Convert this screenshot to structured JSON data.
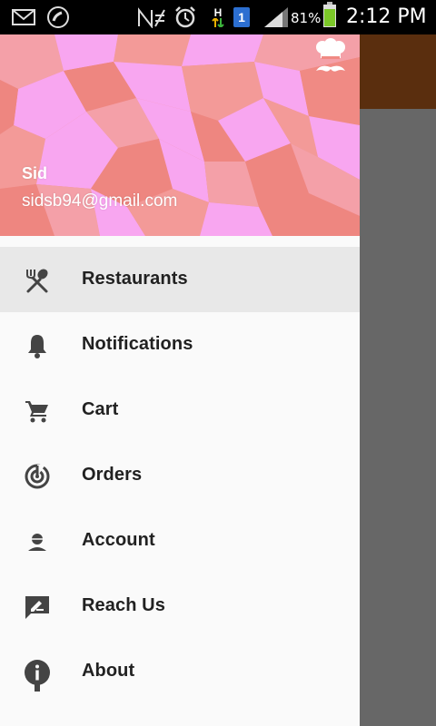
{
  "status_bar": {
    "battery_percent": "81%",
    "time": "2:12 PM",
    "network_type": "H",
    "sim_slot": "1",
    "icons": [
      "mail-icon",
      "missed-call-icon",
      "no-signal-icon",
      "alarm-icon",
      "data-transfer-icon",
      "sim-icon",
      "signal-icon",
      "battery-icon"
    ]
  },
  "drawer": {
    "header": {
      "user_name": "Sid",
      "user_email": "sidsb94@gmail.com",
      "logo_icon": "chef-hat-mustache-icon"
    },
    "menu_items": [
      {
        "label": "Restaurants",
        "icon": "fork-spoon-icon",
        "active": true
      },
      {
        "label": "Notifications",
        "icon": "bell-icon",
        "active": false
      },
      {
        "label": "Cart",
        "icon": "cart-icon",
        "active": false
      },
      {
        "label": "Orders",
        "icon": "radar-icon",
        "active": false
      },
      {
        "label": "Account",
        "icon": "person-icon",
        "active": false
      },
      {
        "label": "Reach Us",
        "icon": "feedback-icon",
        "active": false
      },
      {
        "label": "About",
        "icon": "info-icon",
        "active": false
      }
    ]
  },
  "colors": {
    "header_coral": "#f08a84",
    "header_pink": "#f8a6f0",
    "active_bg": "#e8e8e8",
    "icon_gray": "#444444",
    "scrim": "#676767",
    "app_bar_brown": "#5a2e0e"
  }
}
